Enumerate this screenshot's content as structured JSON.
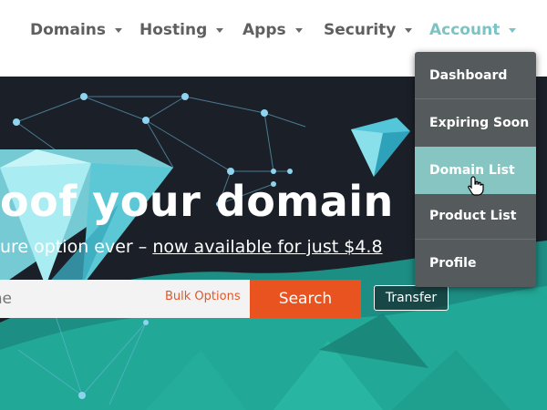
{
  "nav": {
    "items": [
      {
        "label": "Domains"
      },
      {
        "label": "Hosting"
      },
      {
        "label": "Apps"
      },
      {
        "label": "Security"
      },
      {
        "label": "Account"
      }
    ]
  },
  "hero": {
    "headline": "oof your domain",
    "subline_prefix": "ure option ever – ",
    "subline_link": "now available for just $4.8"
  },
  "search": {
    "placeholder": "me",
    "bulk_options": "Bulk Options",
    "search_button": "Search",
    "transfer_button": "Transfer"
  },
  "account_menu": {
    "items": [
      {
        "label": "Dashboard"
      },
      {
        "label": "Expiring Soon"
      },
      {
        "label": "Domain List"
      },
      {
        "label": "Product List"
      },
      {
        "label": "Profile"
      }
    ]
  },
  "colors": {
    "accent": "#7cc3c3",
    "search_button": "#e9531f",
    "menu_bg": "#555a5d",
    "menu_highlight": "#86c5c1",
    "hero_bg": "#1b2028"
  }
}
